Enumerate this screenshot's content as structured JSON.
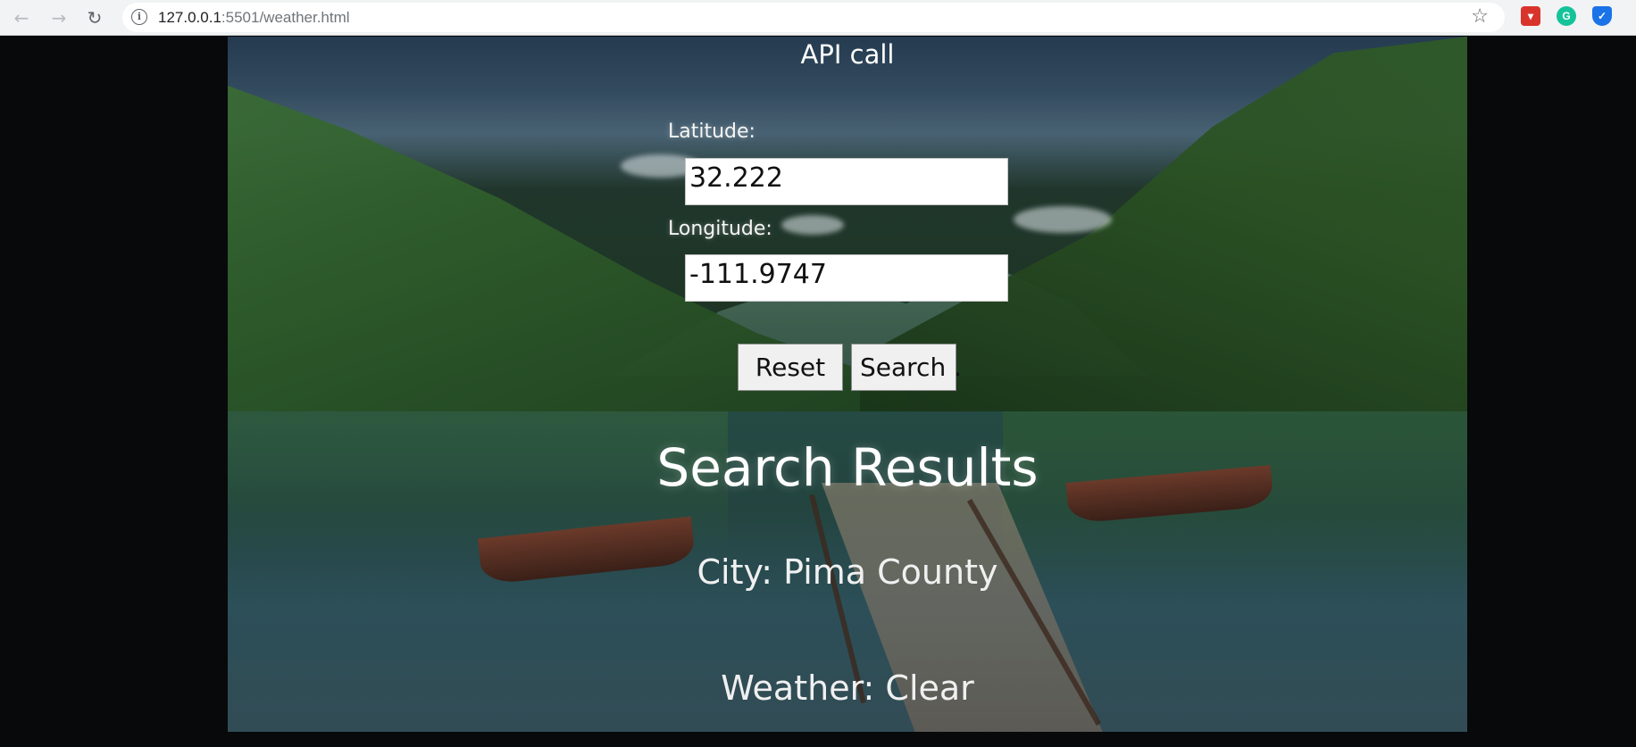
{
  "browser": {
    "url_host": "127.0.0.1",
    "url_rest": ":5501/weather.html"
  },
  "page": {
    "heading": "API call",
    "latitude_label": "Latitude:",
    "latitude_value": "32.222",
    "longitude_label": "Longitude:",
    "longitude_value": "-111.9747",
    "reset_label": "Reset",
    "search_label": "Search .",
    "results_title": "Search Results",
    "city": "City: Pima County",
    "weather": "Weather: Clear"
  }
}
